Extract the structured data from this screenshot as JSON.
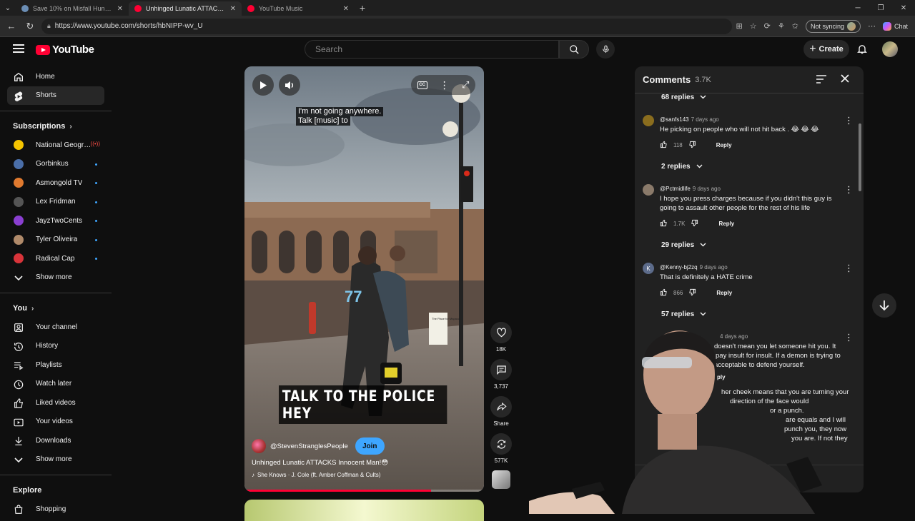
{
  "browser": {
    "tabs": [
      {
        "title": "Save 10% on Misfall Hunter on Steam",
        "active": false,
        "color": "#6b8eb5"
      },
      {
        "title": "Unhinged Lunatic ATTACKS Innocent Man! - YouTube",
        "active": true,
        "color": "#ff0033"
      },
      {
        "title": "YouTube Music",
        "active": false,
        "color": "#ff0033"
      }
    ],
    "url": "https://www.youtube.com/shorts/hbNIPP-wv_U",
    "sync_label": "Not syncing",
    "chat_label": "Chat"
  },
  "header": {
    "logo_text": "YouTube",
    "search_placeholder": "Search",
    "create_label": "Create"
  },
  "sidebar": {
    "main": [
      {
        "label": "Home",
        "icon": "home-icon"
      },
      {
        "label": "Shorts",
        "icon": "shorts-icon",
        "active": true
      }
    ],
    "subscriptions_title": "Subscriptions",
    "subscriptions": [
      {
        "label": "National Geogra...",
        "color": "#f5c400",
        "status": "live"
      },
      {
        "label": "Gorbinkus",
        "color": "#4a6ea8",
        "status": "new"
      },
      {
        "label": "Asmongold TV",
        "color": "#e07a2f",
        "status": "new"
      },
      {
        "label": "Lex Fridman",
        "color": "#555555",
        "status": "new"
      },
      {
        "label": "JayzTwoCents",
        "color": "#8a3fd1",
        "status": "new"
      },
      {
        "label": "Tyler Oliveira",
        "color": "#b08a6a",
        "status": "new"
      },
      {
        "label": "Radical Cap",
        "color": "#d9343a",
        "status": "new"
      }
    ],
    "subscriptions_more": "Show more",
    "you_title": "You",
    "you_items": [
      {
        "label": "Your channel",
        "icon": "your-channel-icon"
      },
      {
        "label": "History",
        "icon": "history-icon"
      },
      {
        "label": "Playlists",
        "icon": "playlists-icon"
      },
      {
        "label": "Watch later",
        "icon": "watch-later-icon"
      },
      {
        "label": "Liked videos",
        "icon": "liked-videos-icon"
      },
      {
        "label": "Your videos",
        "icon": "your-videos-icon"
      },
      {
        "label": "Downloads",
        "icon": "downloads-icon"
      }
    ],
    "you_more": "Show more",
    "explore_title": "Explore",
    "explore_items": [
      {
        "label": "Shopping",
        "icon": "shopping-icon"
      }
    ]
  },
  "short": {
    "caption_lines": [
      "I'm not going anywhere.",
      "Talk [music] to"
    ],
    "cc_label": "CC",
    "burned_text": "TALK TO THE POLICE HEY",
    "channel_handle": "@StevenStranglesPeople",
    "join_label": "Join",
    "title": "Unhinged Lunatic ATTACKS Innocent Man!😳",
    "music": "She Knows · J. Cole (ft. Amber Coffman & Cults)",
    "progress": 0.78,
    "scene_sign": "The Place for Mapaca"
  },
  "actions": {
    "likes": "18K",
    "comments": "3,737",
    "share": "Share",
    "remix": "577K"
  },
  "comments": {
    "title": "Comments",
    "count": "3.7K",
    "reply_label": "Reply",
    "items": [
      {
        "replies_above": "68 replies",
        "user": "@sanfs143",
        "age": "7 days ago",
        "text": "He picking on people who will not hit back . 😂 😂 😂",
        "likes": "118",
        "avatar": "#8a6d1e",
        "initial": ""
      },
      {
        "replies_above": "2 replies",
        "user": "@Pctmidlife",
        "age": "9 days ago",
        "text": "I hope you press charges because if you didn't this guy is going to assault other people for the rest of his life",
        "likes": "1.7K",
        "avatar": "#8a7a6a",
        "initial": ""
      },
      {
        "replies_above": "29 replies",
        "user": "@Kenny-bj2zq",
        "age": "9 days ago",
        "text": "That is definitely a HATE crime",
        "likes": "866",
        "avatar": "#5c6b8a",
        "initial": "K"
      }
    ],
    "trailing_replies": "57 replies",
    "partial": {
      "age": "4 days ago",
      "lines": [
        "doesn't mean you let someone hit you. It",
        "pay insult for insult. If a demon is trying to",
        "acceptable to defend yourself."
      ],
      "reply_fragment": "ply",
      "lines2": [
        "her cheek means that you are turning your",
        "direction of the face would",
        "or a punch.",
        "are equals and I will",
        "punch you, they now",
        "you are. If not they"
      ]
    }
  }
}
